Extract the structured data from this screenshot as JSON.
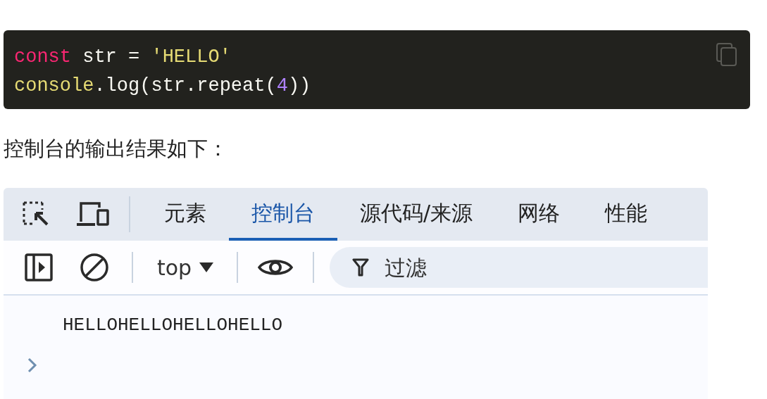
{
  "code_block": {
    "lines": [
      {
        "tokens": [
          {
            "kind": "keyword",
            "text": "const"
          },
          {
            "kind": "plain",
            "text": " str = "
          },
          {
            "kind": "string",
            "text": "'HELLO'"
          }
        ]
      },
      {
        "tokens": [
          {
            "kind": "function",
            "text": "console"
          },
          {
            "kind": "plain",
            "text": ".log(str.repeat("
          },
          {
            "kind": "number",
            "text": "4"
          },
          {
            "kind": "plain",
            "text": "))"
          }
        ]
      }
    ]
  },
  "paragraph": "控制台的输出结果如下：",
  "devtools": {
    "tabs": [
      {
        "label": "元素",
        "selected": false
      },
      {
        "label": "控制台",
        "selected": true
      },
      {
        "label": "源代码/来源",
        "selected": false
      },
      {
        "label": "网络",
        "selected": false
      },
      {
        "label": "性能",
        "selected": false
      }
    ],
    "context": "top",
    "filter": {
      "placeholder": "过滤"
    },
    "output": [
      "HELLOHELLOHELLOHELLO"
    ]
  }
}
